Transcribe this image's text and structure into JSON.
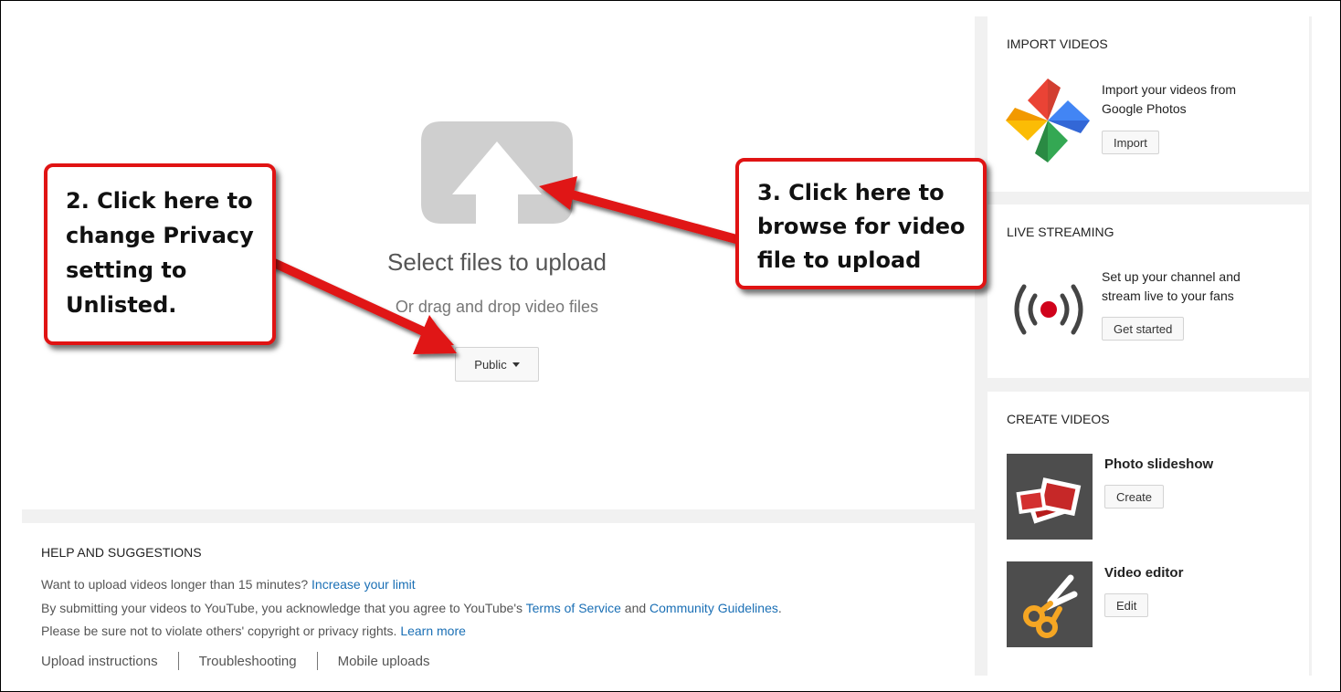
{
  "upload": {
    "title": "Select files to upload",
    "subtitle": "Or drag and drop video files",
    "privacy_label": "Public"
  },
  "help": {
    "title": "HELP AND SUGGESTIONS",
    "line1_text": "Want to upload videos longer than 15 minutes? ",
    "line1_link": "Increase your limit",
    "line2_text_a": "By submitting your videos to YouTube, you acknowledge that you agree to YouTube's ",
    "line2_link_a": "Terms of Service",
    "line2_text_b": " and ",
    "line2_link_b": "Community Guidelines",
    "line2_text_c": ".",
    "line3_text": "Please be sure not to violate others' copyright or privacy rights. ",
    "line3_link": "Learn more",
    "links": [
      "Upload instructions",
      "Troubleshooting",
      "Mobile uploads"
    ]
  },
  "import_card": {
    "title": "IMPORT VIDEOS",
    "text_line1": "Import your videos from",
    "text_line2": "Google Photos",
    "button": "Import",
    "icon": "google-photos-pinwheel-icon"
  },
  "live_card": {
    "title": "LIVE STREAMING",
    "text_line1": "Set up your channel and",
    "text_line2": "stream live to your fans",
    "button": "Get started",
    "icon": "broadcast-icon"
  },
  "create_card": {
    "title": "CREATE VIDEOS",
    "slideshow_label": "Photo slideshow",
    "slideshow_button": "Create",
    "editor_label": "Video editor",
    "editor_button": "Edit"
  },
  "callouts": {
    "privacy": [
      "2. Click here to",
      "change Privacy",
      "setting to",
      "Unlisted."
    ],
    "browse": [
      "3. Click here to",
      "browse for video",
      "file to upload"
    ]
  },
  "colors": {
    "callout_border": "#e01313",
    "link": "#1a6fb5",
    "page_background": "#f1f1f1"
  }
}
